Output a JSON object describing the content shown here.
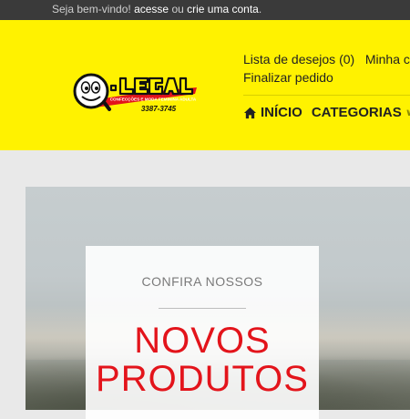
{
  "topbar": {
    "welcome": "Seja bem-vindo!",
    "login_link": "acesse",
    "or": "ou",
    "register_link": "crie uma conta",
    "end": "."
  },
  "logo": {
    "brand": "Q.LEGAL",
    "tagline": "CONFECÇÕES E MODA FEMININA ADULTA",
    "phone": "3387-3745"
  },
  "header_links": {
    "wishlist": "Lista de desejos (0)",
    "account": "Minha conta",
    "checkout": "Finalizar pedido"
  },
  "nav": {
    "home": "INÍCIO",
    "categories": "CATEGORIAS"
  },
  "banner": {
    "eyebrow": "CONFIRA NOSSOS",
    "headline_line1": "NOVOS",
    "headline_line2": "PRODUTOS"
  },
  "colors": {
    "header_bg": "#fff200",
    "topbar_bg": "#3a3a3a",
    "headline": "#e3141b"
  }
}
